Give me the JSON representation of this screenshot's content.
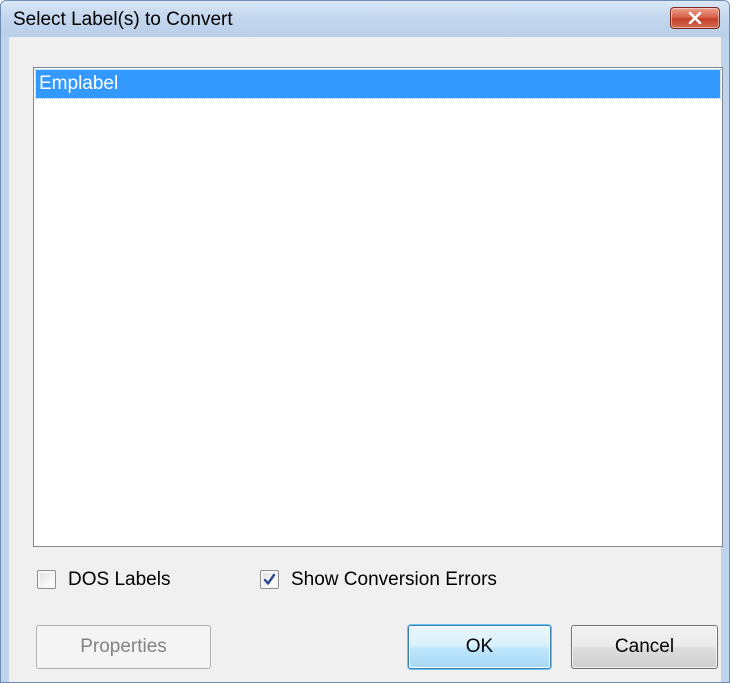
{
  "window": {
    "title": "Select Label(s) to Convert"
  },
  "icons": {
    "close": "close-icon",
    "checkmark": "checkmark-icon"
  },
  "label_list": {
    "items": [
      {
        "label": "Emplabel",
        "selected": true
      }
    ]
  },
  "options": {
    "dos_labels": {
      "label": "DOS Labels",
      "checked": false
    },
    "show_conversion_errors": {
      "label": "Show Conversion Errors",
      "checked": true
    }
  },
  "buttons": {
    "properties": {
      "label": "Properties",
      "enabled": false
    },
    "ok": {
      "label": "OK",
      "default": true
    },
    "cancel": {
      "label": "Cancel"
    }
  },
  "colors": {
    "selection": "#3399ff",
    "close_button": "#c2402a",
    "titlebar": "#c4d7ee",
    "checkmark": "#2b4a8a"
  }
}
